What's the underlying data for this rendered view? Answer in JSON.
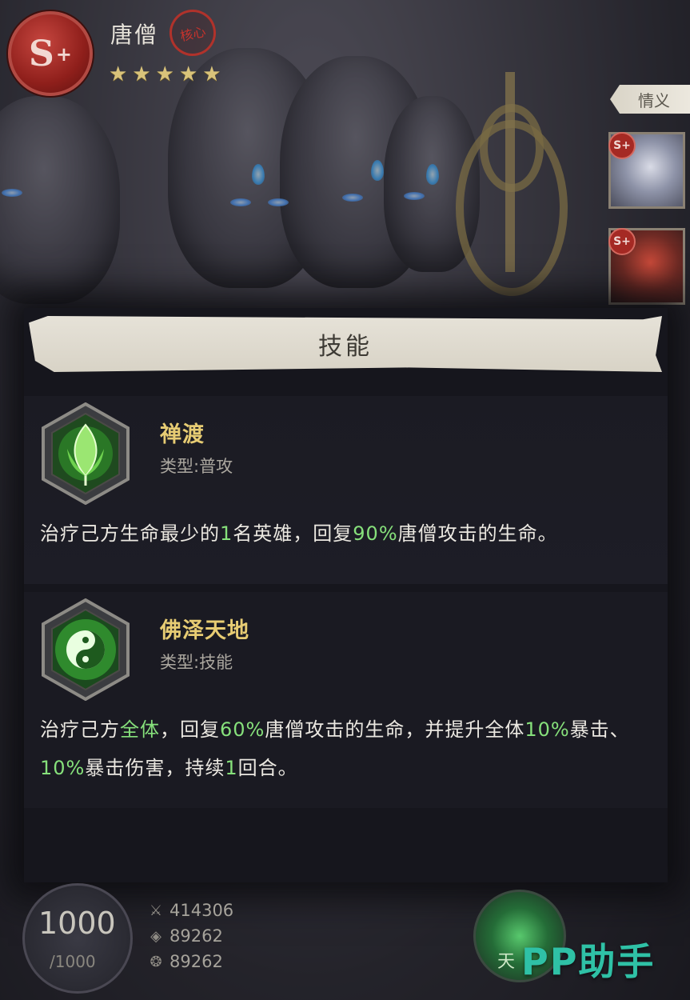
{
  "header": {
    "grade": "S",
    "grade_plus": "+",
    "hero_name": "唐僧",
    "core_tag": "核心",
    "star_count": 5,
    "star_glyph": "★"
  },
  "side_panel": {
    "bond_tab_label": "情义",
    "portraits": [
      {
        "badge": "S+"
      },
      {
        "badge": "S+"
      }
    ]
  },
  "dialog": {
    "title": "技能",
    "skills": [
      {
        "name": "禅渡",
        "type": "类型:普攻",
        "icon": "lotus-leaf-icon",
        "desc_parts": [
          {
            "t": "治疗己方生命最少的",
            "hl": false
          },
          {
            "t": "1",
            "hl": true
          },
          {
            "t": "名英雄，回复",
            "hl": false
          },
          {
            "t": "90%",
            "hl": true
          },
          {
            "t": "唐僧攻击的生命。",
            "hl": false
          }
        ]
      },
      {
        "name": "佛泽天地",
        "type": "类型:技能",
        "icon": "yin-yang-icon",
        "desc_parts": [
          {
            "t": "治疗己方",
            "hl": false
          },
          {
            "t": "全体",
            "hl": true
          },
          {
            "t": "，回复",
            "hl": false
          },
          {
            "t": "60%",
            "hl": true
          },
          {
            "t": "唐僧攻击的生命，并提升全体",
            "hl": false
          },
          {
            "t": "10%",
            "hl": true
          },
          {
            "t": "暴击、",
            "hl": false
          },
          {
            "t": "10%",
            "hl": true
          },
          {
            "t": "暴击伤害，持续",
            "hl": false
          },
          {
            "t": "1",
            "hl": true
          },
          {
            "t": "回合。",
            "hl": false
          }
        ]
      }
    ]
  },
  "footer": {
    "energy_value": "1000",
    "energy_max": "/1000",
    "stats": [
      {
        "icon": "attack-icon",
        "glyph": "⚔",
        "value": "414306"
      },
      {
        "icon": "defense-icon",
        "glyph": "◈",
        "value": "89262"
      },
      {
        "icon": "health-icon",
        "glyph": "❂",
        "value": "89262"
      }
    ],
    "skill_orb_label": "天",
    "watermark": "PP助手"
  },
  "colors": {
    "highlight": "#86e07b",
    "skill_name": "#e7cc73",
    "grade_badge": "#8f1f1b",
    "watermark": "#2fc1a6"
  }
}
